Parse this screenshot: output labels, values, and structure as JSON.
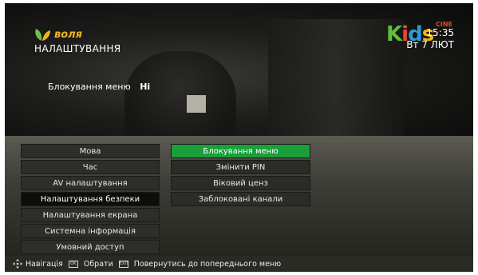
{
  "brand": {
    "name": "воля",
    "colors": {
      "leaf_left": "#6cc04a",
      "leaf_right": "#f2b21e"
    }
  },
  "header": {
    "title": "НАЛАШТУВАННЯ",
    "lock_label": "Блокування меню",
    "lock_value": "Ні",
    "channel_logo": {
      "letters": [
        "K",
        "i",
        "d",
        "s"
      ],
      "badge": "CINE"
    },
    "time": "15:35",
    "date": "Вт 7 ЛЮТ"
  },
  "menu": {
    "items": [
      {
        "label": "Мова"
      },
      {
        "label": "Час"
      },
      {
        "label": "AV налаштування"
      },
      {
        "label": "Налаштування безпеки",
        "active": true
      },
      {
        "label": "Налаштування екрана"
      },
      {
        "label": "Системна інформація"
      },
      {
        "label": "Умовний доступ"
      }
    ],
    "submenu": [
      {
        "label": "Блокування меню",
        "selected": true
      },
      {
        "label": "Змінити PIN"
      },
      {
        "label": "Віковий ценз"
      },
      {
        "label": "Заблоковані канали"
      }
    ]
  },
  "footer": {
    "nav_label": "Навігація",
    "ok_key": "OK",
    "ok_label": "Обрати",
    "exit_key": "EXIT",
    "back_label": "Повернутись до попереднього меню"
  },
  "colors": {
    "selection": "#1aa03a",
    "panel": "#3d3d37",
    "footer": "#2a2a25"
  }
}
